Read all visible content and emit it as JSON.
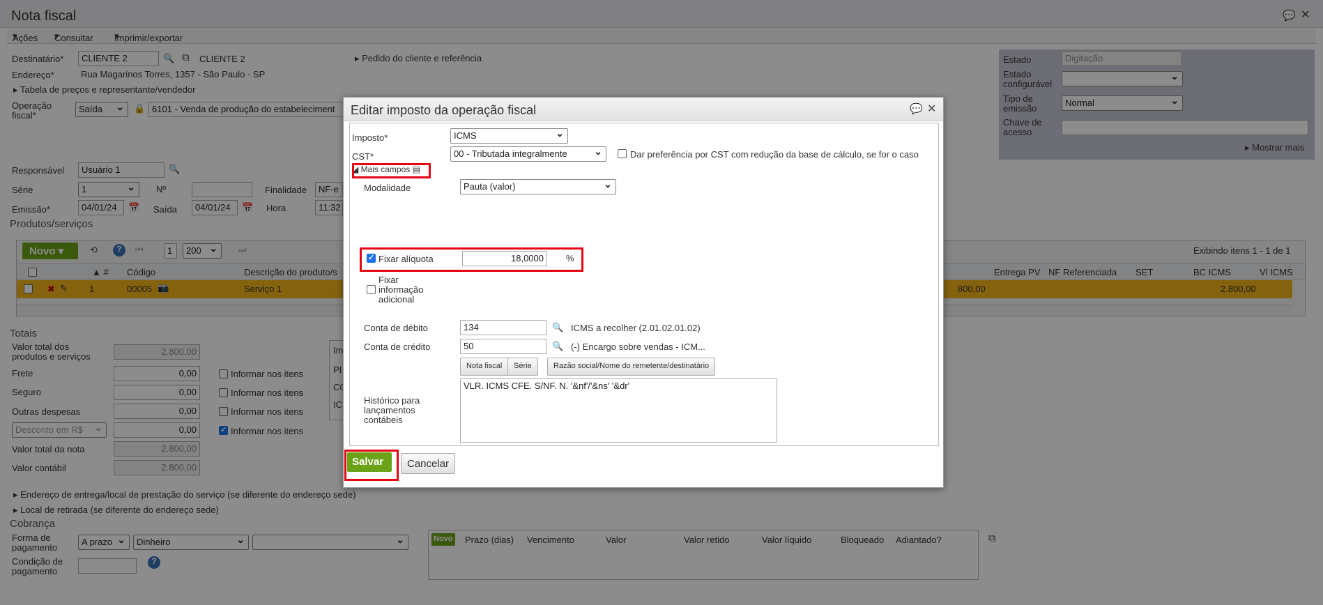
{
  "window": {
    "title": "Nota fiscal"
  },
  "menu": {
    "acoes": "Ações",
    "consultar": "Consultar",
    "imprimir": "Imprimir/exportar"
  },
  "header": {
    "destinatario_label": "Destinatário*",
    "destinatario_value": "CLIENTE 2",
    "destinatario_link": "CLIENTE 2",
    "endereco_label": "Endereço*",
    "endereco_value": "Rua Magarinos Torres, 1357 - São Paulo - SP",
    "tabela_precos": "Tabela de preços e representante/vendedor",
    "pedido_cliente": "Pedido do cliente e referência",
    "operacao_label": "Operação fiscal*",
    "operacao_tipo": "Saída",
    "operacao_value": "6101 - Venda de produção do estabeleciment",
    "responsavel_label": "Responsável",
    "responsavel_value": "Usuário 1",
    "serie_label": "Série",
    "serie_value": "1",
    "numero_label": "Nº",
    "finalidade_label": "Finalidade",
    "finalidade_value": "NF-e",
    "emissao_label": "Emissão*",
    "emissao_value": "04/01/24",
    "saida_label": "Saída",
    "saida_value": "04/01/24",
    "hora_label": "Hora",
    "hora_value": "11:32"
  },
  "status_panel": {
    "estado_label": "Estado",
    "estado_value": "Digitação",
    "estado_config_label": "Estado configurável",
    "estado_config_value": "",
    "tipo_emissao_label": "Tipo de emissão",
    "tipo_emissao_value": "Normal",
    "chave_label": "Chave de acesso",
    "chave_value": "",
    "mostrar_mais": "Mostrar mais"
  },
  "produtos": {
    "title": "Produtos/serviços",
    "novo": "Novo",
    "page": "1",
    "page_size": "200",
    "exibindo": "Exibindo itens 1 - 1 de 1",
    "columns": {
      "num": "#",
      "codigo": "Código",
      "descricao": "Descrição do produto/s",
      "entrega": "Entrega PV",
      "nf_ref": "NF Referenciada",
      "set": "SET",
      "bc_icms": "BC ICMS",
      "vl_icms": "Vl ICMS"
    },
    "row": {
      "num": "1",
      "codigo": "00005",
      "descricao": "Serviço 1",
      "valor": "800,00",
      "bc_icms": "2.800,00"
    }
  },
  "totais": {
    "title": "Totais",
    "valor_total_label": "Valor total dos produtos e serviços",
    "valor_total": "2.800,00",
    "frete_label": "Frete",
    "frete": "0,00",
    "seguro_label": "Seguro",
    "seguro": "0,00",
    "outras_label": "Outras despesas",
    "outras": "0,00",
    "desconto_label": "Desconto em R$",
    "desconto": "0,00",
    "valor_nota_label": "Valor total da nota",
    "valor_nota": "2.800,00",
    "valor_contabil_label": "Valor contábil",
    "valor_contabil": "2.800,00",
    "informar": "Informar nos itens",
    "imp_col": "Im",
    "imp_rows": [
      "PI",
      "CO",
      "IC"
    ]
  },
  "enderecos": {
    "entrega": "Endereço de entrega/local de prestação do serviço (se diferente do endereço sede)",
    "retirada": "Local de retirada (se diferente do endereço sede)"
  },
  "cobranca": {
    "title": "Cobrança",
    "forma_label": "Forma de pagamento",
    "forma_tipo": "A prazo",
    "forma_meio": "Dinheiro",
    "condicao_label": "Condição de pagamento",
    "novo": "Novo",
    "columns": [
      "Prazo (dias)",
      "Vencimento",
      "Valor",
      "Valor retido",
      "Valor líquido",
      "Bloqueado",
      "Adiantado?"
    ]
  },
  "dialog": {
    "title": "Editar imposto da operação fiscal",
    "imposto_label": "Imposto*",
    "imposto_value": "ICMS",
    "cst_label": "CST*",
    "cst_value": "00 - Tributada integralmente",
    "cst_pref": "Dar preferência por CST com redução da base de cálculo, se for o caso",
    "mais_campos": "Mais campos",
    "modalidade_label": "Modalidade",
    "modalidade_value": "Pauta (valor)",
    "fixar_aliquota_label": "Fixar alíquota",
    "aliquota_value": "18,0000",
    "percent": "%",
    "fixar_info_label": "Fixar informação adicional",
    "conta_debito_label": "Conta de débito",
    "conta_debito_value": "134",
    "conta_debito_desc": "ICMS a recolher (2.01.02.01.02)",
    "conta_credito_label": "Conta de crédito",
    "conta_credito_value": "50",
    "conta_credito_desc": "(-) Encargo sobre vendas - ICM...",
    "btn_nota": "Nota fiscal",
    "btn_serie": "Série",
    "btn_razao": "Razão social/Nome do remetente/destinatário",
    "historico_label": "Histórico para lançamentos contábeis",
    "historico_value": "VLR. ICMS CFE. S/NF. N. '&nf'/'&ns' '&dr'",
    "salvar": "Salvar",
    "cancelar": "Cancelar"
  },
  "colors": {
    "accent_green": "#6aa317",
    "highlight_red": "#e30613",
    "row_yellow": "#f2b31a",
    "panel_gray": "#c7c9d6"
  }
}
